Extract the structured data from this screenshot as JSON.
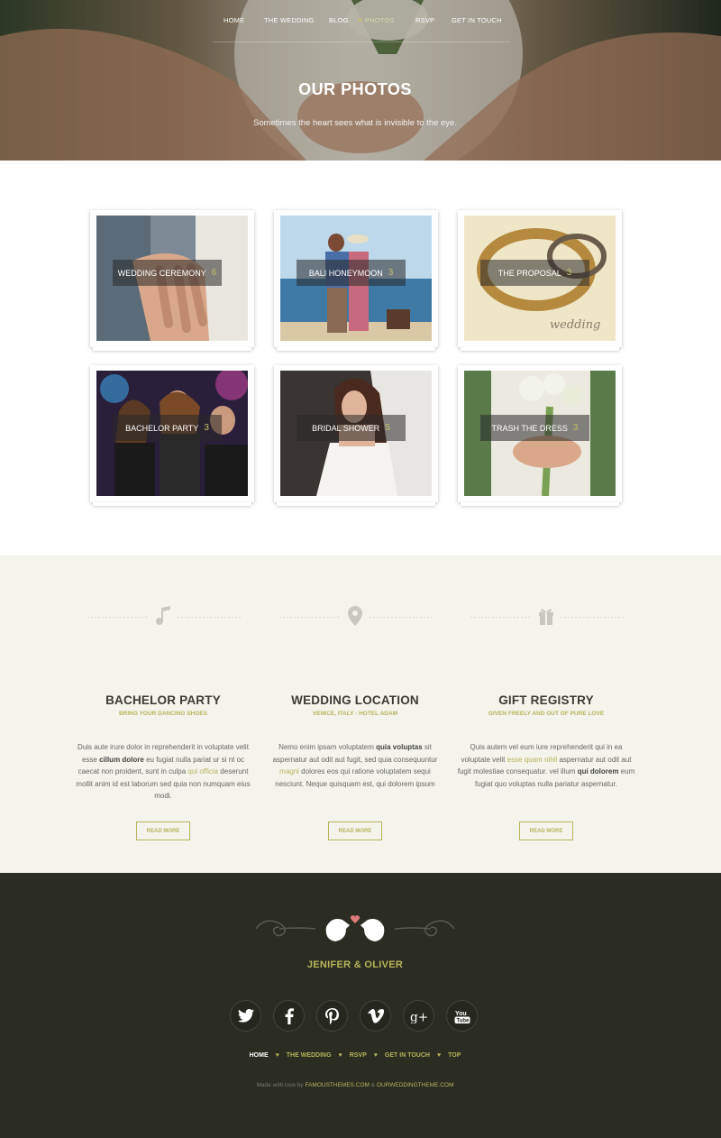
{
  "nav": {
    "items": [
      "HOME",
      "THE WEDDING",
      "BLOG",
      "PHOTOS",
      "RSVP",
      "GET IN TOUCH"
    ],
    "active": "PHOTOS"
  },
  "hero": {
    "title": "OUR PHOTOS",
    "subtitle": "Sometimes the heart sees what is invisible to the eye."
  },
  "gallery": [
    {
      "label": "WEDDING CEREMONY",
      "count": "6"
    },
    {
      "label": "BALI HONEYMOON",
      "count": "3"
    },
    {
      "label": "THE PROPOSAL",
      "count": "3"
    },
    {
      "label": "BACHELOR PARTY",
      "count": "3"
    },
    {
      "label": "BRIDAL SHOWER",
      "count": "5"
    },
    {
      "label": "TRASH THE DRESS",
      "count": "3"
    }
  ],
  "features": [
    {
      "icon": "music-note-icon",
      "title": "BACHELOR PARTY",
      "subtitle": "BRING YOUR DANCING SHOES",
      "body": [
        "Duis aute irure dolor in reprehenderit in voluptate velit esse ",
        "cillum dolore",
        " eu fugiat nulla pariat ur si nt oc caecat non proident, sunt in culpa ",
        "qui officia",
        " deserunt mollit anim id est laborum sed quia non numquam eius modi."
      ],
      "button": "READ MORE"
    },
    {
      "icon": "map-pin-icon",
      "title": "WEDDING LOCATION",
      "subtitle": "VENICE, ITALY - HOTEL ADAM",
      "body": [
        "Nemo enim ipsam voluptatem ",
        "quia voluptas",
        " sit aspernatur aut odit aut fugit, sed quia consequuntur ",
        "magni",
        " dolores eos qui ratione voluptatem sequi nesciunt. Neque quisquam est, qui dolorem ipsum"
      ],
      "button": "READ MORE"
    },
    {
      "icon": "gift-icon",
      "title": "GIFT REGISTRY",
      "subtitle": "GIVEN FREELY AND OUT OF PURE LOVE",
      "body": [
        "Quis autem vel eum iure reprehenderit qui in ea voluptate velit ",
        "esse quam nihil",
        " aspernatur aut odit aut fugit molestiae consequatur. vel illum ",
        "qui dolorem",
        " eum fugiat quo voluptas nulla pariatur aspernatur."
      ],
      "button": "READ MORE"
    }
  ],
  "footer": {
    "names": "JENIFER & OLIVER",
    "socials": [
      "twitter-icon",
      "facebook-icon",
      "pinterest-icon",
      "vimeo-icon",
      "google-plus-icon",
      "youtube-icon"
    ],
    "nav": [
      "HOME",
      "THE WEDDING",
      "RSVP",
      "GET IN TOUCH",
      "TOP"
    ],
    "credit_prefix": "Made with love by ",
    "credit_link1": "FAMOUSTHEMES.COM",
    "credit_mid": " & ",
    "credit_link2": "OURWEDDINGTHEME.COM"
  },
  "colors": {
    "accent": "#b7b55a",
    "footer_bg": "#2b2c22",
    "features_bg": "#f4f3ec",
    "title_dark": "#3c3c32"
  }
}
